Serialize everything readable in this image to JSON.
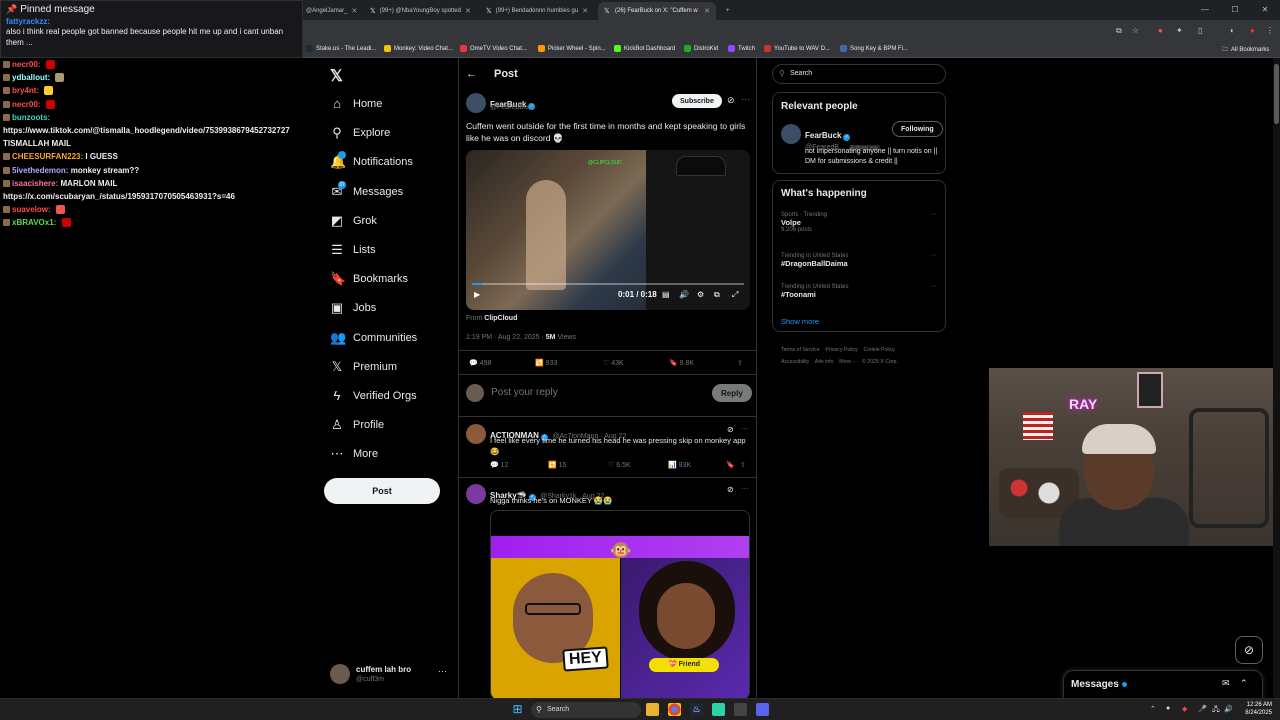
{
  "browser": {
    "tabs": [
      {
        "label": "@AngelJamar_",
        "active": false
      },
      {
        "label": "(99+) @NbaYoungBoy spotted",
        "active": false
      },
      {
        "label": "(99+) Bendadonnn humbles gu",
        "active": false
      },
      {
        "label": "(26) FearBuck on X: \"Cuffem w",
        "active": true
      }
    ],
    "new_tab": "+",
    "bookmarks": [
      {
        "label": "Stake.us - The Leadi...",
        "color": "#1b2a3a"
      },
      {
        "label": "Monkey: Video Chat...",
        "color": "#f5c400"
      },
      {
        "label": "OmeTV Video Chat...",
        "color": "#e34"
      },
      {
        "label": "Picker Wheel - Spin...",
        "color": "#f90"
      },
      {
        "label": "KickBot Dashboard",
        "color": "#53fc18"
      },
      {
        "label": "DistroKid",
        "color": "#2a2"
      },
      {
        "label": "Twitch",
        "color": "#9146ff"
      },
      {
        "label": "YouTube to WAV D...",
        "color": "#c33"
      },
      {
        "label": "Song Key & BPM Fi...",
        "color": "#46a"
      }
    ],
    "all_bookmarks": "All Bookmarks"
  },
  "chat": {
    "pinned_title": "Pinned message",
    "pinned_user": "fattyrackzz:",
    "pinned_text": "also i think real people got banned because people hit me up and i cant unban them ...",
    "messages": [
      {
        "user": "necr00:",
        "color": "#ff4d4d",
        "text": "",
        "emote": "#c00"
      },
      {
        "user": "ydballout:",
        "color": "#9ff",
        "text": "",
        "emote": "#a97"
      },
      {
        "user": "bry4nt:",
        "color": "#ff4d4d",
        "text": "",
        "emote": "#fc3"
      },
      {
        "user": "necr00:",
        "color": "#ff4d4d",
        "text": "",
        "emote": "#c00"
      },
      {
        "user": "bunzoots:",
        "color": "#3bd6c6",
        "text": "",
        "emote": ""
      },
      {
        "user": "",
        "color": "#efeff1",
        "text": "https://www.tiktok.com/@tismalla_hoodlegend/video/7539938679452732727",
        "emote": ""
      },
      {
        "user": "",
        "color": "#efeff1",
        "text": "TISMALLAH MAIL",
        "emote": ""
      },
      {
        "user": "CHEESURFAN223:",
        "color": "#f9a825",
        "text": "I GUESS",
        "emote": ""
      },
      {
        "user": "5ivethedemon:",
        "color": "#b8a3ff",
        "text": "monkey stream??",
        "emote": ""
      },
      {
        "user": "isaacishere:",
        "color": "#ff6fa8",
        "text": "MARLON MAIL",
        "emote": ""
      },
      {
        "user": "",
        "color": "#efeff1",
        "text": "https://x.com/scubaryan_/status/1959317070505463931?s=46",
        "emote": ""
      },
      {
        "user": "suavelow:",
        "color": "#ff4d4d",
        "text": "",
        "emote": "#e55"
      },
      {
        "user": "xBRAVOx1:",
        "color": "#5bd75b",
        "text": "",
        "emote": "#c00"
      }
    ]
  },
  "nav": {
    "items": [
      {
        "label": "Home",
        "icon": "⌂"
      },
      {
        "label": "Explore",
        "icon": "⚲"
      },
      {
        "label": "Notifications",
        "icon": "🔔",
        "badge": ""
      },
      {
        "label": "Messages",
        "icon": "✉",
        "badge": "37"
      },
      {
        "label": "Grok",
        "icon": "◩"
      },
      {
        "label": "Lists",
        "icon": "☰"
      },
      {
        "label": "Bookmarks",
        "icon": "🔖"
      },
      {
        "label": "Jobs",
        "icon": "▣"
      },
      {
        "label": "Communities",
        "icon": "👥"
      },
      {
        "label": "Premium",
        "icon": "𝕏"
      },
      {
        "label": "Verified Orgs",
        "icon": "ϟ"
      },
      {
        "label": "Profile",
        "icon": "♙"
      },
      {
        "label": "More",
        "icon": "⋯"
      }
    ],
    "post_label": "Post",
    "account_name": "cuffem lah bro",
    "account_handle": "@cuff3m"
  },
  "post": {
    "header": "Post",
    "author": "FearBuck",
    "handle": "@FearedBuck",
    "subscribe": "Subscribe",
    "text": "Cuffem went outside for the first time in months and kept speaking to girls like he was on discord 💀",
    "video_time": "0:01 / 0:18",
    "video_watermark": "@CLIPCLOUD",
    "from_label": "From",
    "from_source": "ClipCloud",
    "timestamp": "1:19 PM · Aug 22, 2025 ·",
    "views_count": "5M",
    "views_label": "Views",
    "replies": "498",
    "reposts": "933",
    "likes": "43K",
    "bookmarks": "9.8K",
    "reply_placeholder": "Post your reply",
    "reply_button": "Reply"
  },
  "replies": [
    {
      "author": "ACTIONMAN",
      "handle": "@Ac7ionMann · Aug 22",
      "text": "I feel like every time he turned his head he was pressing skip on monkey app 😂",
      "replies": "12",
      "reposts": "15",
      "likes": "6.5K",
      "views": "93K"
    },
    {
      "author": "Sharky🦈",
      "handle": "@Sharky1k · Aug 22",
      "text": "Nigga thinks he's on MONKEY 😭😭",
      "embed_hey": "HEY",
      "embed_friend": "💝 Friend"
    }
  ],
  "right": {
    "search_placeholder": "Search",
    "relevant_title": "Relevant people",
    "person_name": "FearBuck",
    "person_handle": "@FearedB...",
    "follows_you": "Follows you",
    "following_label": "Following",
    "person_bio": "not impersonating anyone || turn notis on || DM for submissions & credit ||",
    "happening_title": "What's happening",
    "trends": [
      {
        "cat": "Sports · Trending",
        "name": "Volpe",
        "sub": "9,206 posts"
      },
      {
        "cat": "Trending in United States",
        "name": "#DragonBallDaima",
        "sub": ""
      },
      {
        "cat": "Trending in United States",
        "name": "#Toonami",
        "sub": ""
      }
    ],
    "show_more": "Show more",
    "footer": [
      "Terms of Service",
      "Privacy Policy",
      "Cookie Policy",
      "Accessibility",
      "Ads info",
      "More ···",
      "© 2025 X Corp."
    ]
  },
  "webcam_neon": "RAY",
  "messages_drawer": "Messages",
  "taskbar": {
    "search": "Search",
    "time": "12:26 AM",
    "date": "8/24/2025"
  },
  "colors": {
    "accent": "#1d9bf0",
    "background": "#000000",
    "chat_bg": "#18181b"
  }
}
